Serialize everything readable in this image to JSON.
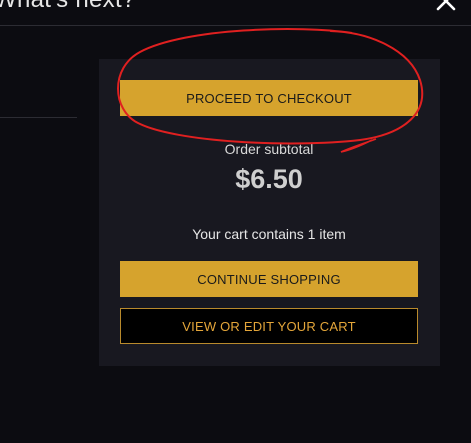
{
  "dialog": {
    "title": "What's next?"
  },
  "icons": {
    "close": "close-icon"
  },
  "cart_panel": {
    "checkout_label": "PROCEED TO CHECKOUT",
    "subtotal_label": "Order subtotal",
    "subtotal_amount": "$6.50",
    "cart_count_text": "Your cart contains 1 item",
    "continue_label": "CONTINUE SHOPPING",
    "edit_cart_label": "VIEW OR EDIT YOUR CART"
  },
  "colors": {
    "background": "#0c0c11",
    "panel": "#181820",
    "accent": "#d6a32d",
    "annotation": "#e02020"
  }
}
